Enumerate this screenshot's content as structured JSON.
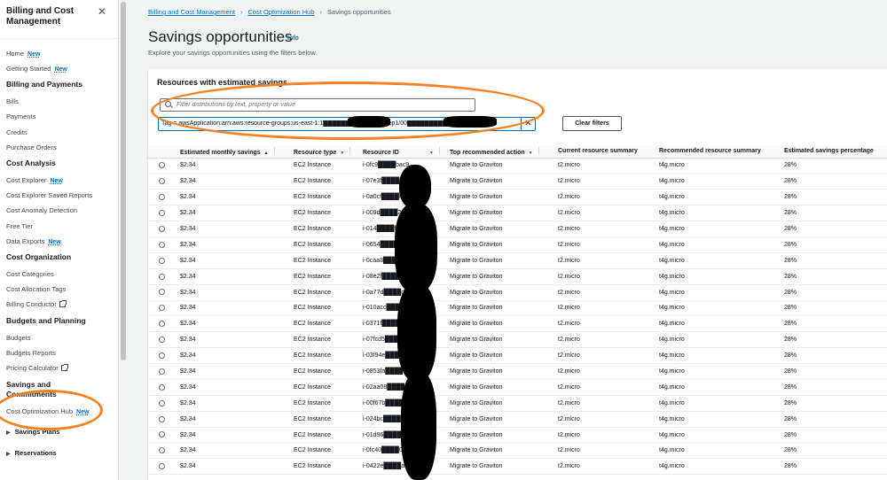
{
  "sidebar": {
    "title": "Billing and Cost Management",
    "items": [
      {
        "label": "Home",
        "badge": "New"
      },
      {
        "label": "Getting Started",
        "badge": "New"
      }
    ],
    "sections": {
      "billing": {
        "heading": "Billing and Payments",
        "items": [
          "Bills",
          "Payments",
          "Credits",
          "Purchase Orders"
        ]
      },
      "cost_analysis": {
        "heading": "Cost Analysis",
        "items": [
          "Cost Explorer",
          "Cost Explorer Saved Reports",
          "Cost Anomaly Detection",
          "Free Tier",
          "Data Exports"
        ],
        "new_badges": {
          "explorer": "New",
          "exports": "New"
        }
      },
      "cost_org": {
        "heading": "Cost Organization",
        "items": [
          "Cost Categories",
          "Cost Allocation Tags",
          "Billing Conductor"
        ]
      },
      "budgets": {
        "heading": "Budgets and Planning",
        "items": [
          "Budgets",
          "Budgets Reports",
          "Pricing Calculator"
        ]
      },
      "savings": {
        "heading": "Savings and Commitments",
        "items": [
          "Cost Optimization Hub",
          "Savings Plans",
          "Reservations"
        ],
        "hub_badge": "New"
      }
    }
  },
  "breadcrumb": {
    "items": [
      "Billing and Cost Management",
      "Cost Optimization Hub"
    ],
    "current": "Savings opportunities"
  },
  "page": {
    "title": "Savings opportunities",
    "info": "Info",
    "subtitle": "Explore your savings opportunities using the filters below."
  },
  "panel": {
    "title": "Resources with estimated savings",
    "search_placeholder": "Filter distributions by text, property or value",
    "token_text": "Tag = awsApplication:arn:aws:resource-groups:us-east-1:1██████████group/dep1/00████████████jsco8",
    "clear_label": "Clear filters"
  },
  "table": {
    "columns": [
      "Estimated monthly savings",
      "Resource type",
      "Resource ID",
      "Top recommended action",
      "Current resource summary",
      "Recommended resource summary",
      "Estimated savings percentage"
    ],
    "rows": [
      [
        "$2.34",
        "EC2 Instance",
        "i-0fc9████bac9",
        "Migrate to Graviton",
        "t2.micro",
        "t4g.micro",
        "28%"
      ],
      [
        "$2.34",
        "EC2 Instance",
        "i-07e3f████b826",
        "Migrate to Graviton",
        "t2.micro",
        "t4g.micro",
        "28%"
      ],
      [
        "$2.34",
        "EC2 Instance",
        "i-0a0cf████f3e",
        "Migrate to Graviton",
        "t2.micro",
        "t4g.micro",
        "28%"
      ],
      [
        "$2.34",
        "EC2 Instance",
        "i-009d████24b8dc",
        "Migrate to Graviton",
        "t2.micro",
        "t4g.micro",
        "28%"
      ],
      [
        "$2.34",
        "EC2 Instance",
        "i-014████fe48",
        "Migrate to Graviton",
        "t2.micro",
        "t4g.micro",
        "28%"
      ],
      [
        "$2.34",
        "EC2 Instance",
        "i-0654████ebf1a6",
        "Migrate to Graviton",
        "t2.micro",
        "t4g.micro",
        "28%"
      ],
      [
        "$2.34",
        "EC2 Instance",
        "i-0caa8████7fc",
        "Migrate to Graviton",
        "t2.micro",
        "t4g.micro",
        "28%"
      ],
      [
        "$2.34",
        "EC2 Instance",
        "i-08e2f████de795",
        "Migrate to Graviton",
        "t2.micro",
        "t4g.micro",
        "28%"
      ],
      [
        "$2.34",
        "EC2 Instance",
        "i-0a77d████dd28",
        "Migrate to Graviton",
        "t2.micro",
        "t4g.micro",
        "28%"
      ],
      [
        "$2.34",
        "EC2 Instance",
        "i-010acc████80",
        "Migrate to Graviton",
        "t2.micro",
        "t4g.micro",
        "28%"
      ],
      [
        "$2.34",
        "EC2 Instance",
        "i-0371f████23c",
        "Migrate to Graviton",
        "t2.micro",
        "t4g.micro",
        "28%"
      ],
      [
        "$2.34",
        "EC2 Instance",
        "i-07fcd5████d1",
        "Migrate to Graviton",
        "t2.micro",
        "t4g.micro",
        "28%"
      ],
      [
        "$2.34",
        "EC2 Instance",
        "i-03f94e████66",
        "Migrate to Graviton",
        "t2.micro",
        "t4g.micro",
        "28%"
      ],
      [
        "$2.34",
        "EC2 Instance",
        "i-0853fa████b01",
        "Migrate to Graviton",
        "t2.micro",
        "t4g.micro",
        "28%"
      ],
      [
        "$2.34",
        "EC2 Instance",
        "i-02aa08████da0",
        "Migrate to Graviton",
        "t2.micro",
        "t4g.micro",
        "28%"
      ],
      [
        "$2.34",
        "EC2 Instance",
        "i-00f67b████ec1",
        "Migrate to Graviton",
        "t2.micro",
        "t4g.micro",
        "28%"
      ],
      [
        "$2.34",
        "EC2 Instance",
        "i-024bc████f6b",
        "Migrate to Graviton",
        "t2.micro",
        "t4g.micro",
        "28%"
      ],
      [
        "$2.34",
        "EC2 Instance",
        "i-01d96████766",
        "Migrate to Graviton",
        "t2.micro",
        "t4g.micro",
        "28%"
      ],
      [
        "$2.34",
        "EC2 Instance",
        "i-0fc40████075",
        "Migrate to Graviton",
        "t2.micro",
        "t4g.micro",
        "28%"
      ],
      [
        "$2.34",
        "EC2 Instance",
        "i-0422e████a9",
        "Migrate to Graviton",
        "t2.micro",
        "t4g.micro",
        "28%"
      ]
    ]
  },
  "colors": {
    "accent": "#0073bb",
    "annotation": "#f58220",
    "redaction": "#000000"
  }
}
